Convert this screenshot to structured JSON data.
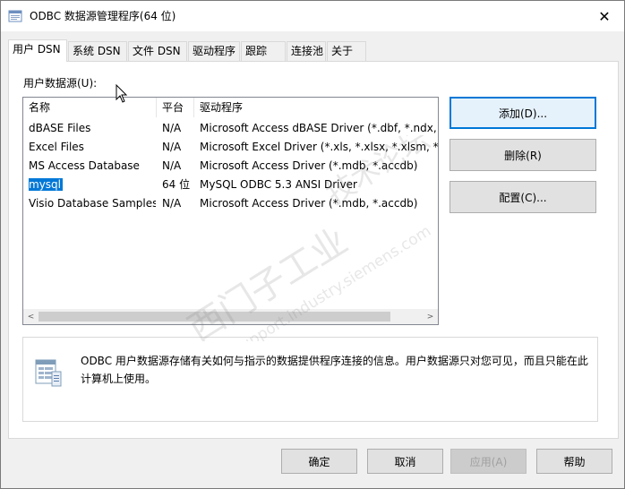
{
  "window": {
    "title": "ODBC 数据源管理程序(64 位)"
  },
  "tabs": [
    {
      "label": "用户 DSN",
      "active": true
    },
    {
      "label": "系统 DSN"
    },
    {
      "label": "文件 DSN"
    },
    {
      "label": "驱动程序"
    },
    {
      "label": "跟踪"
    },
    {
      "label": "连接池"
    },
    {
      "label": "关于"
    }
  ],
  "user_dsn": {
    "section_label": "用户数据源(U):",
    "columns": [
      "名称",
      "平台",
      "驱动程序"
    ],
    "rows": [
      {
        "name": "dBASE Files",
        "platform": "N/A",
        "driver": "Microsoft Access dBASE Driver (*.dbf, *.ndx, *"
      },
      {
        "name": "Excel Files",
        "platform": "N/A",
        "driver": "Microsoft Excel Driver (*.xls, *.xlsx, *.xlsm, *.xlsb)"
      },
      {
        "name": "MS Access Database",
        "platform": "N/A",
        "driver": "Microsoft Access Driver (*.mdb, *.accdb)"
      },
      {
        "name": "mysql",
        "platform": "64 位",
        "driver": "MySQL ODBC 5.3 ANSI Driver",
        "selected": true
      },
      {
        "name": "Visio Database Samples",
        "platform": "N/A",
        "driver": "Microsoft Access Driver (*.mdb, *.accdb)"
      }
    ],
    "buttons": {
      "add": "添加(D)...",
      "remove": "删除(R)",
      "configure": "配置(C)..."
    },
    "info": "ODBC 用户数据源存储有关如何与指示的数据提供程序连接的信息。用户数据源只对您可见，而且只能在此计算机上使用。"
  },
  "footer": {
    "ok": "确定",
    "cancel": "取消",
    "apply": "应用(A)",
    "help": "帮助"
  },
  "watermark": {
    "line1": "西门子工业",
    "line2": "support.industry.siemens.com",
    "line3": "技术论坛"
  },
  "colors": {
    "selection": "#0078d7",
    "default_button_border": "#0078d7"
  }
}
